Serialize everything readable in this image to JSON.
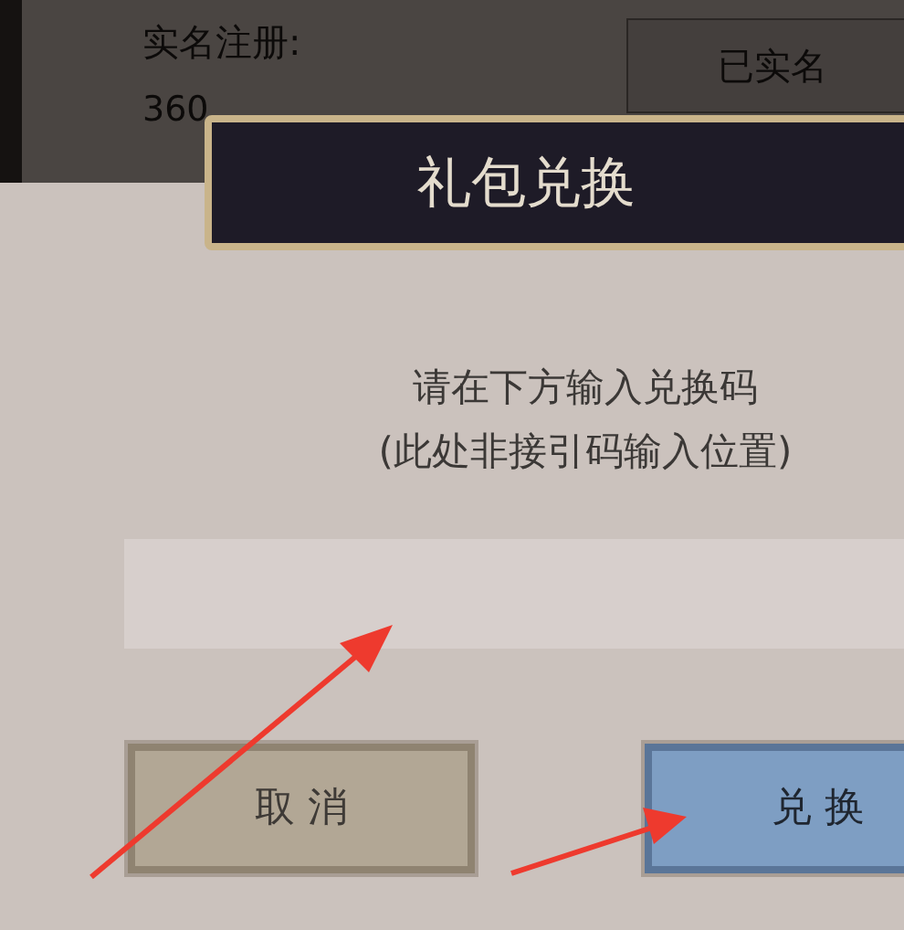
{
  "background_page": {
    "label": "实名注册:",
    "value": "360",
    "status_button": "已实名"
  },
  "dialog": {
    "title": "礼包兑换",
    "instructions": [
      "请在下方输入兑换码",
      "(此处非接引码输入位置)"
    ],
    "buttons": [
      {
        "label": "取 消",
        "kind": "cancel"
      },
      {
        "label": "兑 换",
        "kind": "confirm"
      }
    ]
  }
}
